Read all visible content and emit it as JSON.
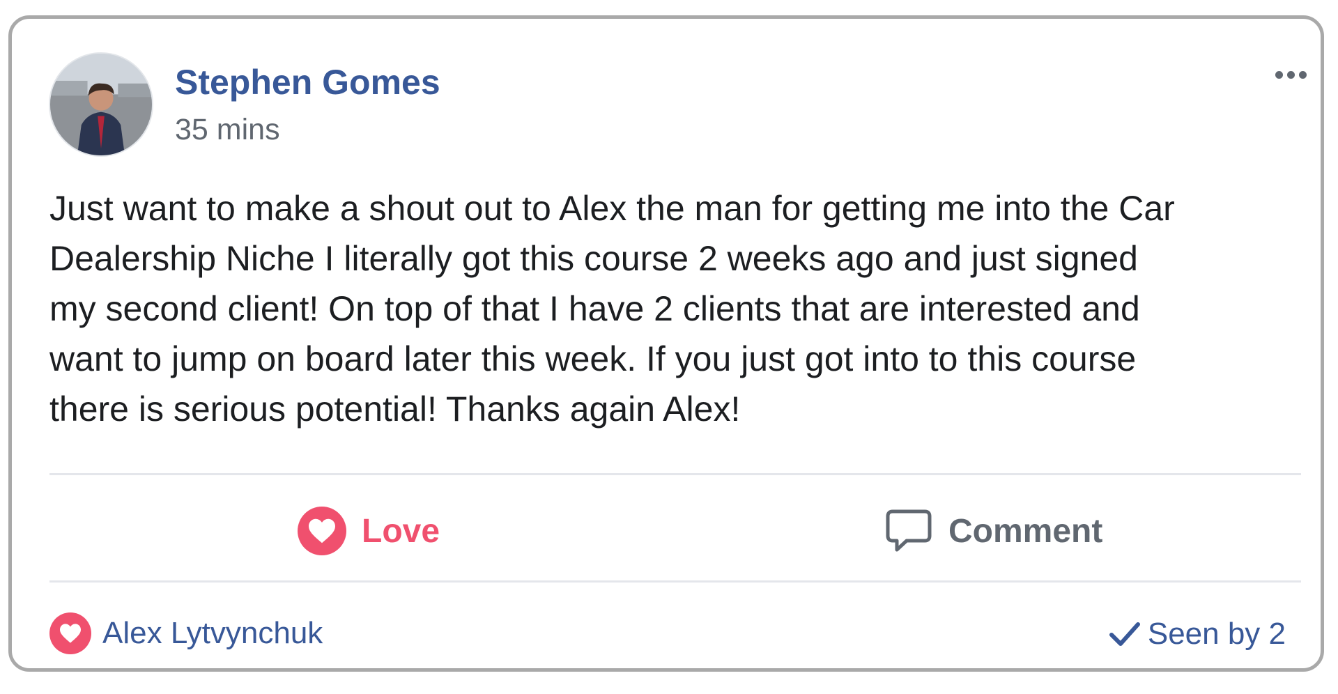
{
  "post": {
    "author": "Stephen Gomes",
    "time": "35 mins",
    "text": "Just want to make a shout out to Alex the man for getting me into the Car\nDealership Niche I literally got this course 2 weeks ago and just signed\nmy second client! On top of that I have 2 clients that are interested and\nwant to jump on board later this week. If you just got into to this course\nthere is serious potential! Thanks again Alex!"
  },
  "actions": {
    "love_label": "Love",
    "comment_label": "Comment"
  },
  "footer": {
    "reactor_name": "Alex Lytvynchuk",
    "seen_label": "Seen by 2"
  },
  "icons": {
    "avatar": "profile-photo",
    "more": "more-options-icon",
    "love": "heart-icon",
    "comment": "comment-bubble-icon",
    "reaction": "heart-icon",
    "seen": "checkmark-icon"
  },
  "colors": {
    "link_blue": "#385898",
    "love_red": "#f0506e",
    "secondary_gray": "#606770",
    "text_dark": "#1c1e21"
  }
}
